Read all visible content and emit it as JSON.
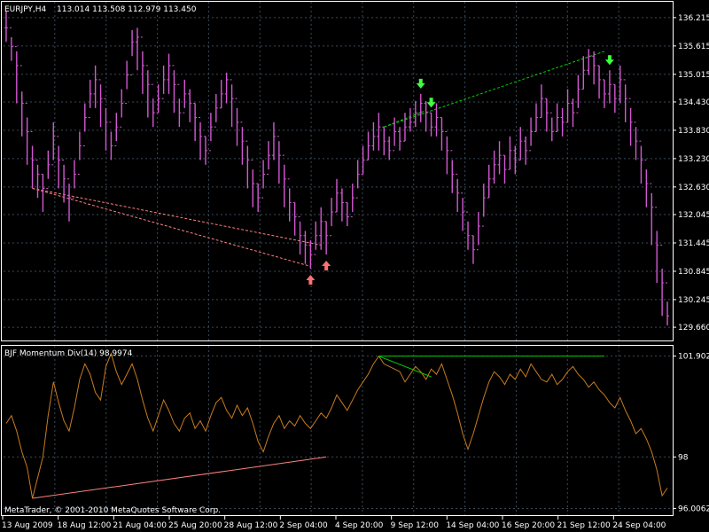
{
  "header": {
    "symbol_timeframe": "EURJPY,H4",
    "ohlc": "113.014 113.508 112.979 113.450"
  },
  "indicator": {
    "label": "BJF Momentum Div(14) 98.9974"
  },
  "footer": {
    "copyright": "MetaTrader, © 2001-2010 MetaQuotes Software Corp."
  },
  "colors": {
    "background": "#000000",
    "grid": "#3a4a5a",
    "frame": "#ffffff",
    "price_bars": "#d258d2",
    "momentum_line": "#c87c1e",
    "bearish_divergence": "#00d000",
    "bullish_divergence": "#ff8080",
    "up_arrow": "#ff7070",
    "down_arrow": "#40ff40"
  },
  "chart_data": [
    {
      "type": "bar",
      "panel": "price",
      "symbol": "EURJPY",
      "timeframe": "H4",
      "ylim": [
        129.38,
        136.55
      ],
      "y_ticks": [
        "136.215",
        "135.615",
        "135.015",
        "134.430",
        "133.830",
        "133.230",
        "132.630",
        "132.045",
        "131.445",
        "130.845",
        "130.245",
        "129.660"
      ],
      "x_ticks": [
        "13 Aug 2009",
        "18 Aug 12:00",
        "21 Aug 04:00",
        "25 Aug 20:00",
        "28 Aug 12:00",
        "2 Sep 04:00",
        "4 Sep 20:00",
        "9 Sep 12:00",
        "14 Sep 04:00",
        "16 Sep 20:00",
        "21 Sep 12:00",
        "24 Sep 04:00"
      ],
      "series": [
        {
          "closes": [
            136.0,
            135.6,
            135.2,
            134.4,
            133.8,
            133.2,
            132.9,
            132.6,
            133.1,
            133.7,
            133.2,
            132.8,
            132.4,
            132.9,
            133.5,
            134.1,
            134.6,
            134.9,
            134.5,
            134.0,
            133.5,
            133.9,
            134.4,
            135.0,
            135.7,
            135.8,
            135.2,
            134.8,
            134.2,
            134.5,
            134.9,
            135.2,
            134.8,
            134.2,
            134.6,
            134.4,
            134.1,
            133.7,
            133.4,
            133.9,
            134.3,
            134.6,
            134.9,
            134.5,
            134.0,
            133.6,
            133.2,
            132.7,
            132.4,
            132.9,
            133.3,
            133.7,
            133.3,
            132.8,
            132.3,
            132.0,
            131.6,
            131.4,
            131.2,
            131.6,
            131.9,
            131.6,
            132.1,
            132.5,
            132.3,
            132.0,
            132.4,
            132.9,
            133.2,
            133.5,
            133.7,
            133.9,
            133.6,
            133.4,
            133.8,
            133.6,
            133.9,
            134.0,
            134.2,
            134.4,
            134.2,
            133.9,
            134.1,
            133.8,
            133.4,
            132.9,
            132.5,
            132.1,
            131.6,
            131.3,
            131.8,
            132.4,
            132.8,
            133.1,
            133.3,
            133.0,
            133.4,
            133.2,
            133.6,
            133.4,
            133.8,
            134.1,
            134.5,
            134.2,
            133.8,
            134.1,
            134.0,
            134.4,
            134.2,
            134.7,
            135.1,
            135.4,
            135.2,
            134.9,
            134.6,
            134.8,
            134.5,
            134.9,
            134.5,
            134.0,
            133.6,
            133.2,
            132.7,
            132.2,
            131.4,
            130.6,
            129.9
          ],
          "highs": [
            136.35,
            135.8,
            135.5,
            134.65,
            134.1,
            133.5,
            133.1,
            132.9,
            133.4,
            134.0,
            133.5,
            133.1,
            132.7,
            133.2,
            133.8,
            134.4,
            134.9,
            135.2,
            134.8,
            134.3,
            133.8,
            134.2,
            134.7,
            135.3,
            135.95,
            136.0,
            135.5,
            135.1,
            134.5,
            134.8,
            135.2,
            135.45,
            135.1,
            134.5,
            134.9,
            134.7,
            134.4,
            134.0,
            133.7,
            134.2,
            134.6,
            134.9,
            135.05,
            134.8,
            134.3,
            133.9,
            133.5,
            133.0,
            132.7,
            133.2,
            133.6,
            134.0,
            133.6,
            133.1,
            132.6,
            132.3,
            131.9,
            131.7,
            131.5,
            131.9,
            132.2,
            131.9,
            132.4,
            132.8,
            132.6,
            132.3,
            132.7,
            133.2,
            133.5,
            133.8,
            134.0,
            134.2,
            133.9,
            133.7,
            134.1,
            133.9,
            134.2,
            134.3,
            134.45,
            134.6,
            134.45,
            134.2,
            134.4,
            134.1,
            133.7,
            133.2,
            132.8,
            132.4,
            131.9,
            131.6,
            132.1,
            132.7,
            133.1,
            133.4,
            133.6,
            133.3,
            133.7,
            133.5,
            133.9,
            133.7,
            134.1,
            134.4,
            134.8,
            134.5,
            134.1,
            134.4,
            134.3,
            134.7,
            134.5,
            135.0,
            135.4,
            135.55,
            135.5,
            135.2,
            134.9,
            135.1,
            134.8,
            135.2,
            134.8,
            134.3,
            133.9,
            133.5,
            133.0,
            132.5,
            131.7,
            130.9,
            130.2
          ],
          "lows": [
            135.7,
            135.3,
            134.4,
            133.7,
            133.1,
            132.6,
            132.4,
            132.1,
            132.8,
            133.2,
            132.6,
            132.3,
            131.9,
            132.6,
            133.2,
            133.8,
            134.3,
            134.3,
            133.9,
            133.4,
            133.2,
            133.6,
            134.1,
            134.7,
            135.4,
            135.1,
            134.6,
            134.1,
            133.9,
            134.2,
            134.6,
            134.6,
            134.2,
            133.9,
            134.3,
            134.0,
            133.6,
            133.2,
            133.1,
            133.6,
            134.0,
            134.3,
            134.4,
            133.9,
            133.5,
            133.1,
            132.6,
            132.2,
            132.1,
            132.6,
            133.0,
            133.2,
            132.7,
            132.2,
            131.9,
            131.6,
            131.2,
            131.0,
            130.9,
            131.3,
            131.3,
            131.2,
            131.8,
            132.1,
            131.9,
            131.8,
            132.1,
            132.6,
            132.9,
            133.2,
            133.4,
            133.4,
            133.3,
            133.2,
            133.5,
            133.4,
            133.6,
            133.8,
            133.9,
            134.0,
            133.8,
            133.7,
            133.7,
            133.4,
            132.9,
            132.5,
            132.1,
            131.7,
            131.3,
            131.0,
            131.4,
            132.0,
            132.4,
            132.7,
            132.9,
            132.7,
            133.0,
            132.9,
            133.2,
            133.1,
            133.5,
            133.8,
            134.1,
            133.8,
            133.6,
            133.8,
            133.7,
            134.0,
            133.9,
            134.3,
            134.7,
            135.0,
            134.8,
            134.5,
            134.3,
            134.4,
            134.2,
            134.4,
            134.0,
            133.5,
            133.2,
            132.7,
            132.2,
            131.4,
            130.6,
            129.9,
            129.7
          ]
        }
      ],
      "divergence_lines": [
        {
          "kind": "bullish",
          "style": "dashed",
          "points": [
            [
              5,
              132.6
            ],
            [
              58,
              130.95
            ]
          ]
        },
        {
          "kind": "bullish",
          "style": "dashed",
          "points": [
            [
              5,
              132.6
            ],
            [
              60,
              131.4
            ]
          ]
        },
        {
          "kind": "bearish",
          "style": "dashed",
          "points": [
            [
              72,
              133.9
            ],
            [
              114,
              135.5
            ]
          ]
        },
        {
          "kind": "bearish",
          "style": "dashed",
          "points": [
            [
              72,
              133.9
            ],
            [
              80,
              134.25
            ]
          ]
        }
      ],
      "arrows": [
        {
          "direction": "up",
          "index": 58
        },
        {
          "direction": "up",
          "index": 61
        },
        {
          "direction": "down",
          "index": 79
        },
        {
          "direction": "down",
          "index": 81
        },
        {
          "direction": "down",
          "index": 115
        }
      ]
    },
    {
      "type": "line",
      "panel": "indicator",
      "name": "BJF Momentum Div(14)",
      "ylim": [
        95.75,
        102.3
      ],
      "y_ticks": [
        "101.9024",
        "98",
        "96.0062"
      ],
      "series": [
        {
          "name": "BJF Momentum Div(14)",
          "values": [
            99.3,
            99.6,
            99.0,
            98.2,
            97.6,
            96.4,
            97.2,
            98.0,
            99.6,
            100.9,
            100.1,
            99.4,
            99.0,
            99.9,
            101.0,
            101.6,
            101.2,
            100.5,
            100.2,
            101.5,
            102.0,
            101.3,
            100.8,
            101.2,
            101.6,
            101.0,
            100.2,
            99.5,
            99.0,
            99.6,
            100.2,
            99.8,
            99.3,
            99.0,
            99.5,
            99.7,
            99.1,
            99.4,
            99.0,
            99.6,
            100.1,
            100.3,
            99.8,
            99.5,
            100.0,
            99.6,
            99.9,
            99.3,
            98.6,
            98.2,
            98.8,
            99.3,
            99.6,
            99.1,
            99.4,
            99.2,
            99.6,
            99.3,
            99.1,
            99.4,
            99.7,
            99.5,
            99.9,
            100.4,
            100.1,
            99.8,
            100.2,
            100.6,
            100.9,
            101.2,
            101.6,
            101.9,
            101.6,
            101.5,
            101.4,
            101.3,
            100.9,
            101.2,
            101.5,
            101.3,
            101.0,
            101.4,
            101.2,
            101.6,
            101.0,
            100.4,
            99.7,
            98.9,
            98.3,
            98.9,
            99.6,
            100.3,
            100.9,
            101.3,
            101.1,
            100.8,
            101.2,
            101.0,
            101.4,
            101.1,
            101.6,
            101.3,
            101.0,
            100.9,
            101.2,
            100.8,
            101.0,
            101.3,
            101.5,
            101.2,
            101.0,
            100.7,
            100.9,
            100.6,
            100.4,
            100.1,
            99.9,
            100.3,
            99.8,
            99.4,
            98.9,
            99.1,
            98.7,
            98.2,
            97.5,
            96.5,
            96.8
          ]
        }
      ],
      "divergence_lines": [
        {
          "kind": "bullish",
          "style": "solid",
          "points": [
            [
              5,
              96.4
            ],
            [
              61,
              98.0
            ]
          ]
        },
        {
          "kind": "bearish",
          "style": "solid",
          "points": [
            [
              71,
              101.9
            ],
            [
              114,
              101.9
            ]
          ]
        },
        {
          "kind": "bearish",
          "style": "solid",
          "points": [
            [
              71,
              101.9
            ],
            [
              81,
              101.1
            ]
          ]
        }
      ]
    }
  ]
}
